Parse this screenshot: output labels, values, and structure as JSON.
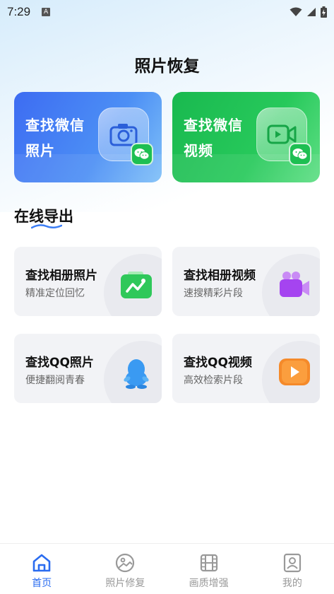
{
  "status_bar": {
    "time": "7:29",
    "notification_badge": "A"
  },
  "page_title": "照片恢复",
  "feature_cards": [
    {
      "line1": "查找微信",
      "line2": "照片",
      "icon": "camera-icon",
      "color": "#3d6cf2"
    },
    {
      "line1": "查找微信",
      "line2": "视频",
      "icon": "video-icon",
      "color": "#19b94f"
    }
  ],
  "section": {
    "title": "在线导出"
  },
  "export_cards": [
    {
      "title": "查找相册照片",
      "subtitle": "精准定位回忆",
      "icon": "gallery-icon"
    },
    {
      "title": "查找相册视频",
      "subtitle": "速搜精彩片段",
      "icon": "video-camera-icon"
    },
    {
      "title": "查找QQ照片",
      "subtitle": "便捷翻阅青春",
      "icon": "qq-penguin-icon"
    },
    {
      "title": "查找QQ视频",
      "subtitle": "高效检索片段",
      "icon": "play-icon"
    }
  ],
  "tabbar": {
    "items": [
      {
        "label": "首页",
        "icon": "home-icon",
        "active": true
      },
      {
        "label": "照片修复",
        "icon": "image-repair-icon",
        "active": false
      },
      {
        "label": "画质增强",
        "icon": "film-icon",
        "active": false
      },
      {
        "label": "我的",
        "icon": "profile-icon",
        "active": false
      }
    ]
  },
  "colors": {
    "accent": "#2a6cf0",
    "inactive": "#999999"
  }
}
